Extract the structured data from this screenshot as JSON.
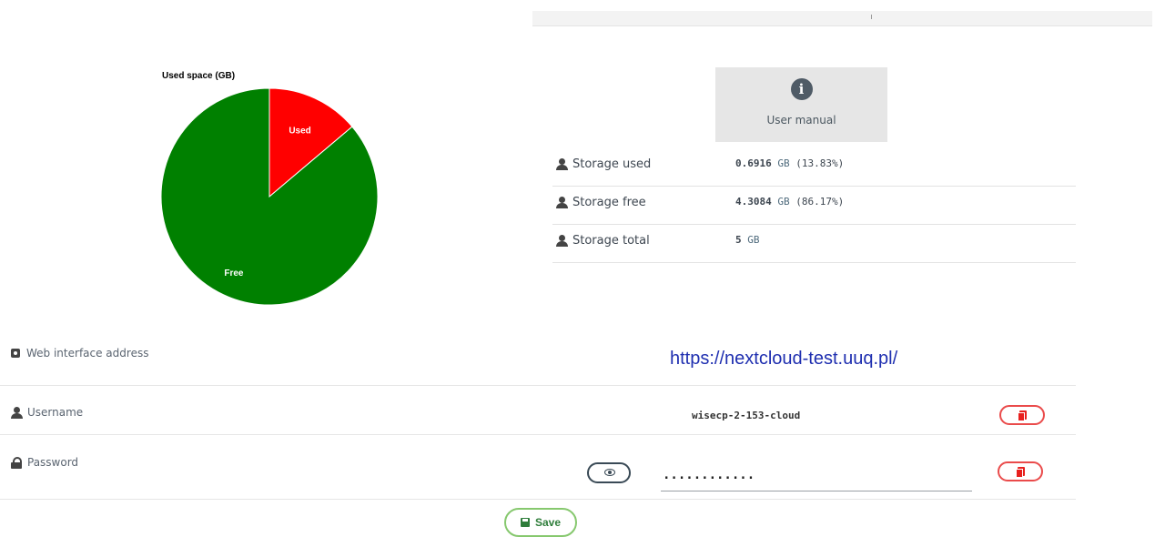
{
  "chart_data": {
    "type": "pie",
    "title": "Used space (GB)",
    "categories": [
      "Used",
      "Free"
    ],
    "values": [
      0.6916,
      4.3084
    ],
    "colors": [
      "#ff0000",
      "#008000"
    ]
  },
  "manual": {
    "label": "User manual",
    "icon": "info-icon"
  },
  "storage": {
    "rows": [
      {
        "label": "Storage used",
        "value": "0.6916",
        "unit": "GB",
        "extra": "(13.83%)"
      },
      {
        "label": "Storage free",
        "value": "4.3084",
        "unit": "GB",
        "extra": "(86.17%)"
      },
      {
        "label": "Storage total",
        "value": "5",
        "unit": "GB",
        "extra": ""
      }
    ]
  },
  "form": {
    "web_label": "Web interface address",
    "web_url": "https://nextcloud-test.uuq.pl/",
    "username_label": "Username",
    "username_value": "wisecp-2-153-cloud",
    "password_label": "Password",
    "password_value": "............",
    "save_label": "Save"
  }
}
